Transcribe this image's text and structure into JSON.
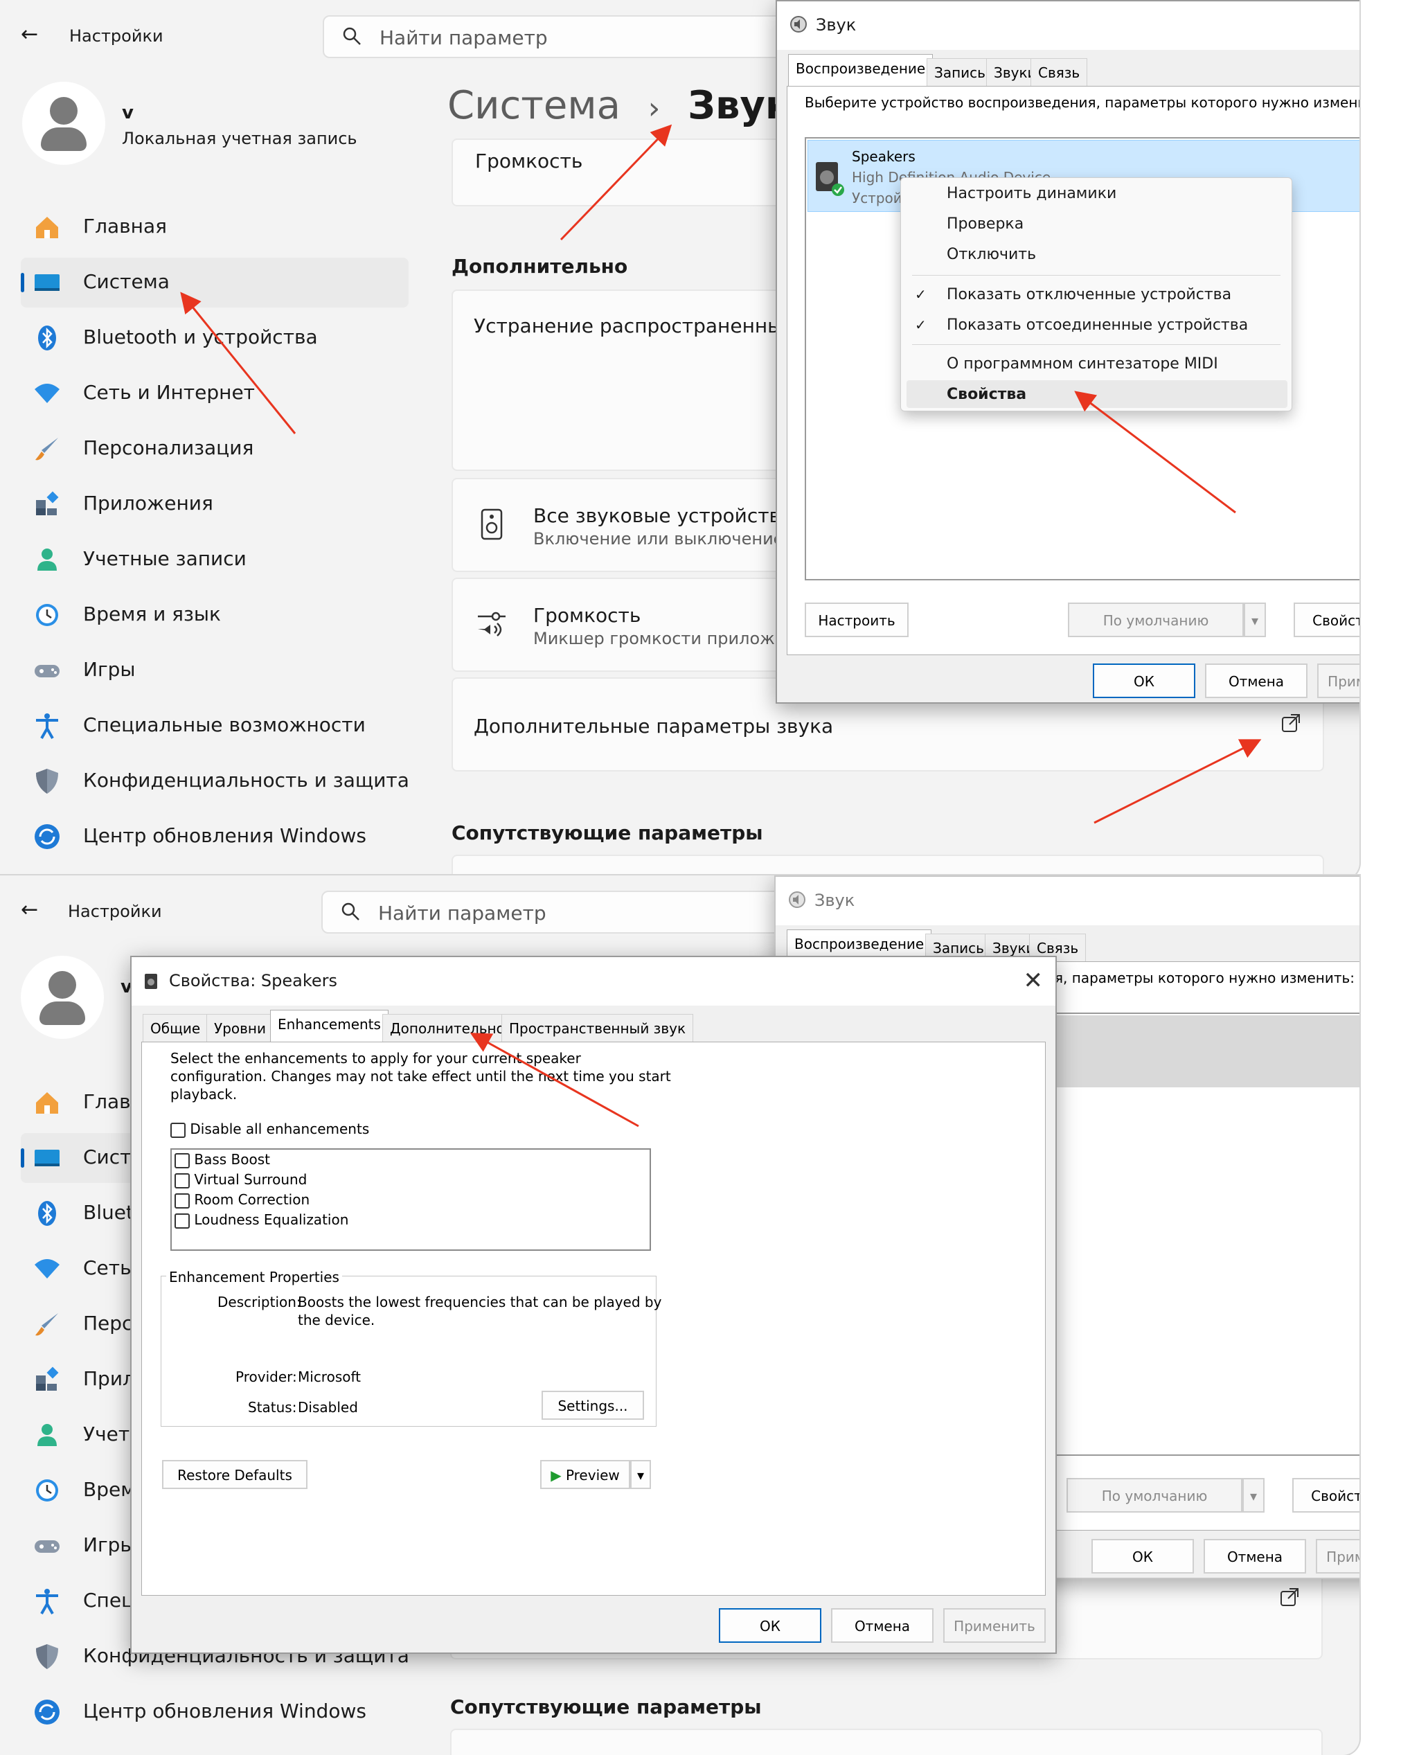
{
  "settings": {
    "back_label": "←",
    "app_title": "Настройки",
    "search_placeholder": "Найти параметр",
    "account_name": "v",
    "account_type": "Локальная учетная запись",
    "breadcrumb_parent": "Система",
    "breadcrumb_sep": "›",
    "breadcrumb_current": "Звук",
    "nav": [
      {
        "label": "Главная",
        "icon": "home-icon"
      },
      {
        "label": "Система",
        "icon": "system-icon"
      },
      {
        "label": "Bluetooth и устройства",
        "icon": "bluetooth-icon"
      },
      {
        "label": "Сеть и Интернет",
        "icon": "wifi-icon"
      },
      {
        "label": "Персонализация",
        "icon": "brush-icon"
      },
      {
        "label": "Приложения",
        "icon": "apps-icon"
      },
      {
        "label": "Учетные записи",
        "icon": "account-icon"
      },
      {
        "label": "Время и язык",
        "icon": "clock-icon"
      },
      {
        "label": "Игры",
        "icon": "gamepad-icon"
      },
      {
        "label": "Специальные возможности",
        "icon": "accessibility-icon"
      },
      {
        "label": "Конфиденциальность и защита",
        "icon": "shield-icon"
      },
      {
        "label": "Центр обновления Windows",
        "icon": "update-icon"
      }
    ],
    "nav_truncated": [
      "Главн",
      "Систе",
      "Blueto",
      "Сеть и",
      "Персо",
      "Прило",
      "Учетн",
      "Время",
      "Игры",
      "Специ",
      "Конфиденциальность и защита",
      "Центр обновления Windows"
    ],
    "volume_card": "Громкость",
    "section_additional": "Дополнительно",
    "troubleshoot": "Устранение распространенных пр",
    "all_devices_title": "Все звуковые устройства",
    "all_devices_sub": "Включение или выключение ус",
    "mixer_title": "Громкость",
    "mixer_sub": "Микшер громкости приложени",
    "more_sound": "Дополнительные параметры звука",
    "related": "Сопутствующие параметры"
  },
  "sound_dialog": {
    "title": "Звук",
    "tabs": [
      "Воспроизведение",
      "Запись",
      "Звуки",
      "Связь"
    ],
    "instruction": "Выберите устройство воспроизведения, параметры которого нужно изменить:",
    "instruction_partial": "ия, параметры которого нужно изменить:",
    "device_name": "Speakers",
    "device_desc": "High Definition Audio Device",
    "device_status": "Устройство",
    "btn_configure": "Настроить",
    "btn_default": "По умолчанию",
    "btn_properties": "Свойства",
    "btn_ok": "ОК",
    "btn_cancel": "Отмена",
    "btn_apply": "Применить"
  },
  "context_menu": {
    "items": [
      "Настроить динамики",
      "Проверка",
      "Отключить"
    ],
    "checked": [
      "Показать отключенные устройства",
      "Показать отсоединенные устройства"
    ],
    "check_mark": "✓",
    "midi": "О программном синтезаторе MIDI",
    "properties": "Свойства"
  },
  "props_dialog": {
    "title": "Свойства: Speakers",
    "tabs": [
      "Общие",
      "Уровни",
      "Enhancements",
      "Дополнительно",
      "Пространственный звук"
    ],
    "intro_lines": [
      "Select the enhancements to apply for your current speaker",
      "configuration. Changes may not take effect until the next time you start",
      "playback."
    ],
    "disable_all": "Disable all enhancements",
    "enhancements": [
      "Bass Boost",
      "Virtual Surround",
      "Room Correction",
      "Loudness Equalization"
    ],
    "group_title": "Enhancement Properties",
    "desc_label": "Description:",
    "desc_lines": [
      "Boosts the lowest frequencies that can be played by",
      "the device."
    ],
    "provider_label": "Provider:",
    "provider_value": "Microsoft",
    "status_label": "Status:",
    "status_value": "Disabled",
    "settings_btn": "Settings...",
    "restore_btn": "Restore Defaults",
    "preview_btn": "Preview",
    "ok": "ОК",
    "cancel": "Отмена",
    "apply": "Применить"
  },
  "colors": {
    "accent": "#005fb8",
    "annotation_arrow": "#e8351f"
  }
}
